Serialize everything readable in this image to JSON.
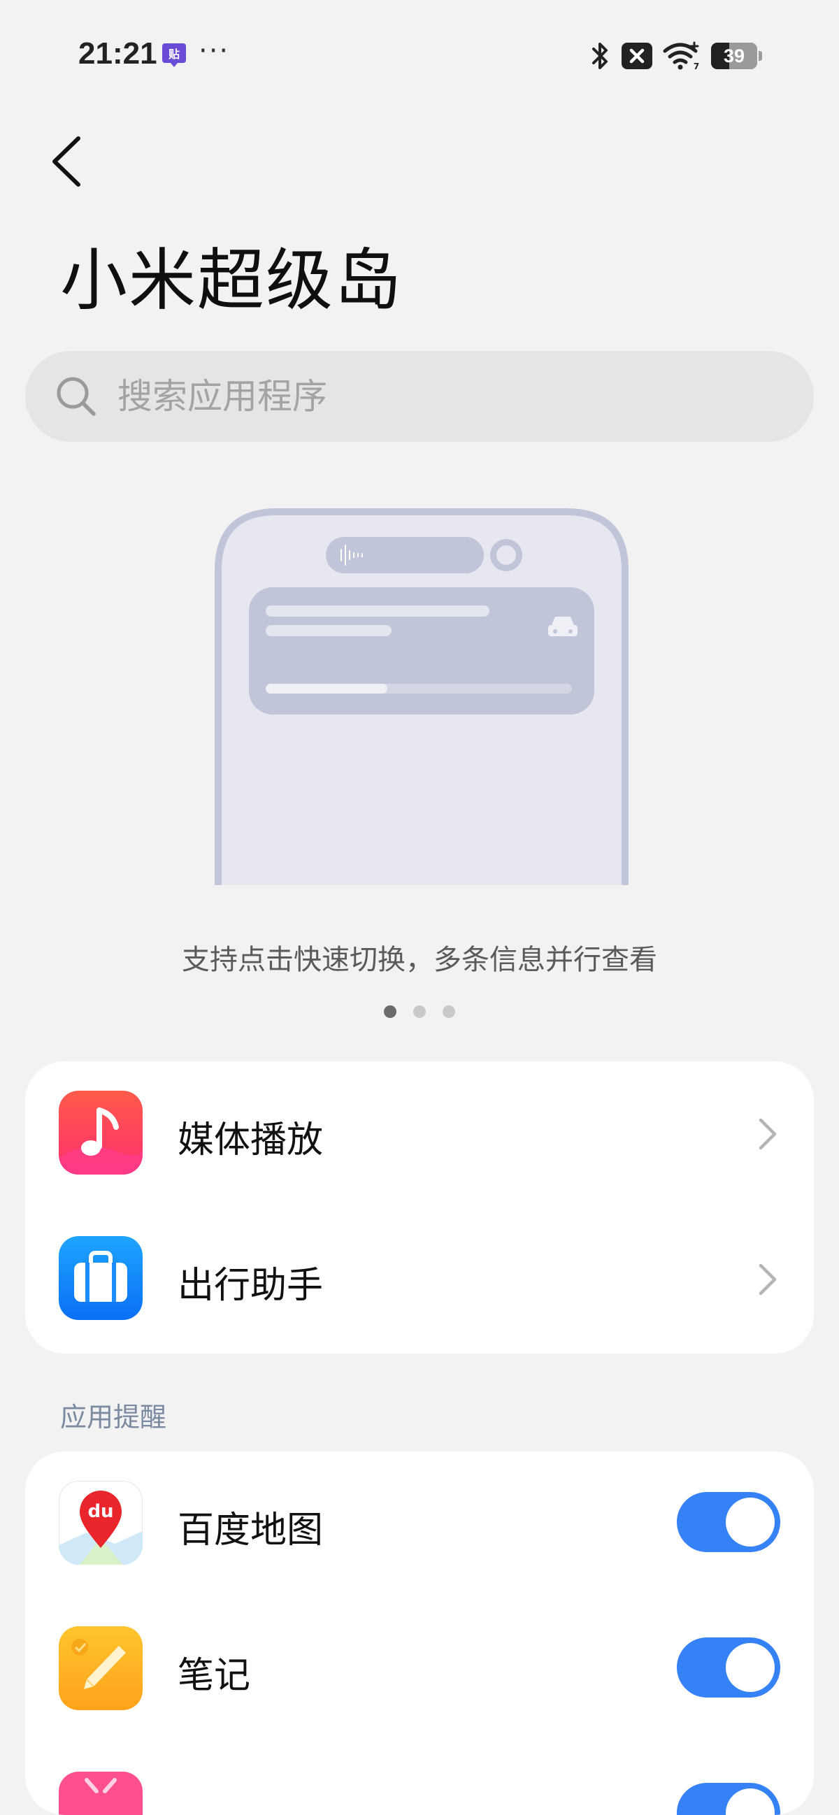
{
  "status_bar": {
    "time": "21:21",
    "app_icon": "tieba-notification-icon",
    "more_dots": "···",
    "battery_level": "39",
    "icons": [
      "bluetooth-icon",
      "sim-disabled-icon",
      "wifi-icon",
      "battery-icon"
    ]
  },
  "header": {
    "back_icon": "back-chevron-icon",
    "title": "小米超级岛"
  },
  "search": {
    "placeholder": "搜索应用程序",
    "icon": "search-icon"
  },
  "carousel": {
    "caption": "支持点击快速切换，多条信息并行查看",
    "page_count": 3,
    "active_page": 0
  },
  "main_list": {
    "items": [
      {
        "label": "媒体播放",
        "icon": "music-app-icon"
      },
      {
        "label": "出行助手",
        "icon": "travel-assistant-icon"
      }
    ]
  },
  "app_reminders": {
    "section_title": "应用提醒",
    "items": [
      {
        "label": "百度地图",
        "icon": "baidu-maps-icon",
        "enabled": true
      },
      {
        "label": "笔记",
        "icon": "notes-app-icon",
        "enabled": true
      },
      {
        "label": "",
        "icon": "pink-app-icon",
        "enabled": true
      }
    ]
  },
  "colors": {
    "accent": "#3482f6",
    "background": "#f2f2f2",
    "card": "#ffffff",
    "section_label": "#7a8aa0"
  }
}
